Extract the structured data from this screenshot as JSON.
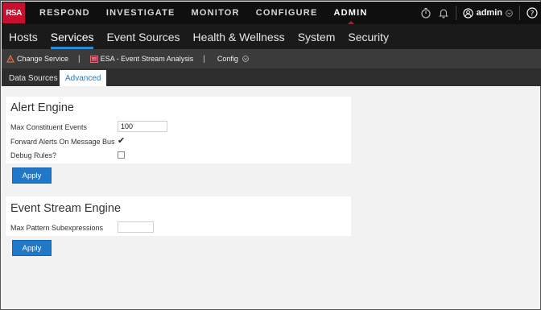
{
  "topbar": {
    "logo": "RSA",
    "nav": [
      "RESPOND",
      "INVESTIGATE",
      "MONITOR",
      "CONFIGURE",
      "ADMIN"
    ],
    "active": "ADMIN",
    "user": "admin",
    "icons": [
      "timer-icon",
      "bell-icon",
      "user-circle-icon",
      "chevron-down-icon",
      "help-icon"
    ]
  },
  "secondnav": {
    "items": [
      "Hosts",
      "Services",
      "Event Sources",
      "Health & Wellness",
      "System",
      "Security"
    ],
    "active": "Services"
  },
  "servicebar": {
    "change_service": "Change Service",
    "service_name": "ESA - Event Stream Analysis",
    "view": "Config"
  },
  "tabs": {
    "data_sources": "Data Sources",
    "advanced": "Advanced",
    "active": "Advanced"
  },
  "alert_engine": {
    "title": "Alert Engine",
    "max_constituent_label": "Max Constituent Events",
    "max_constituent_value": "100",
    "forward_alerts_label": "Forward Alerts On Message Bus",
    "forward_alerts_checked": true,
    "debug_rules_label": "Debug Rules?",
    "debug_rules_checked": false,
    "apply": "Apply"
  },
  "event_stream_engine": {
    "title": "Event Stream Engine",
    "max_pattern_label": "Max Pattern Subexpressions",
    "max_pattern_value": "",
    "apply": "Apply"
  },
  "colors": {
    "brand_red": "#c8102e",
    "accent_blue": "#1f78c8",
    "tab_active_text": "#2a7ab8"
  }
}
